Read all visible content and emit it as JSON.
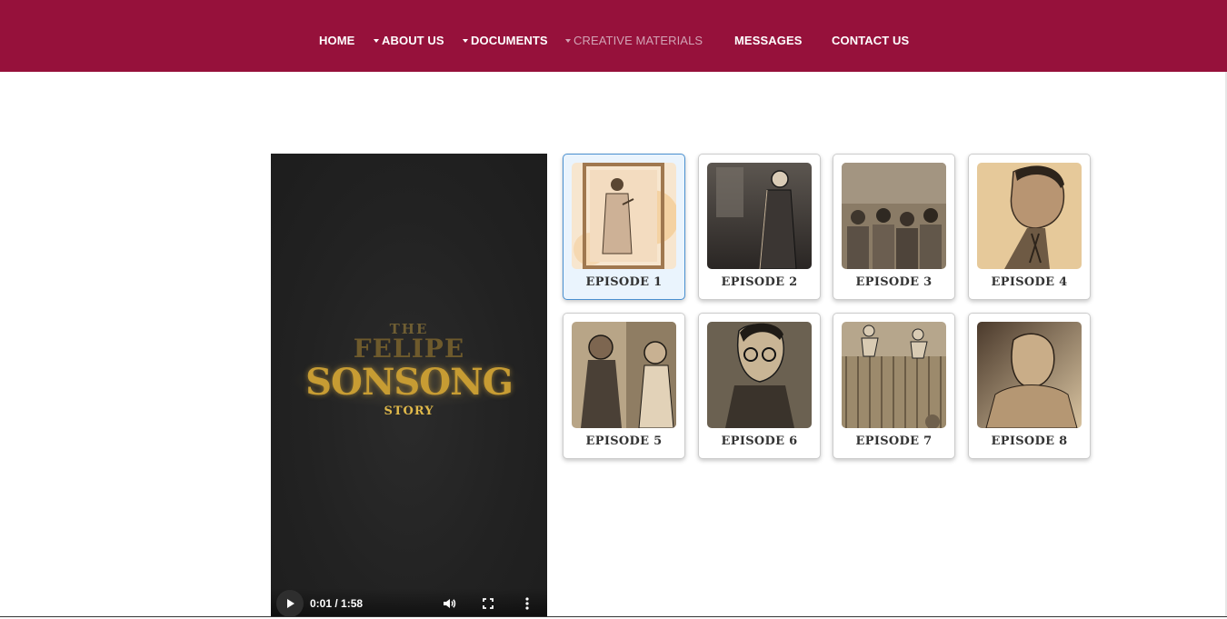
{
  "nav": {
    "items": [
      {
        "label": "HOME",
        "dropdown": false,
        "active": false
      },
      {
        "label": "ABOUT US",
        "dropdown": true,
        "active": false
      },
      {
        "label": "DOCUMENTS",
        "dropdown": true,
        "active": false
      },
      {
        "label": "CREATIVE MATERIALS",
        "dropdown": true,
        "active": true
      },
      {
        "label": "MESSAGES",
        "dropdown": false,
        "active": false
      },
      {
        "label": "CONTACT US",
        "dropdown": false,
        "active": false
      }
    ],
    "bg_color": "#96113b"
  },
  "video": {
    "title_line1": "THE",
    "title_line2": "FELIPE",
    "title_line3": "SONSONG",
    "title_line4": "STORY",
    "time": "0:01 / 1:58",
    "controls": [
      "play-icon",
      "volume-icon",
      "fullscreen-icon",
      "more-options-icon"
    ]
  },
  "episodes": [
    {
      "label": "EPISODE 1",
      "selected": true
    },
    {
      "label": "EPISODE 2",
      "selected": false
    },
    {
      "label": "EPISODE 3",
      "selected": false
    },
    {
      "label": "EPISODE 4",
      "selected": false
    },
    {
      "label": "EPISODE 5",
      "selected": false
    },
    {
      "label": "EPISODE 6",
      "selected": false
    },
    {
      "label": "EPISODE 7",
      "selected": false
    },
    {
      "label": "EPISODE 8",
      "selected": false
    }
  ]
}
